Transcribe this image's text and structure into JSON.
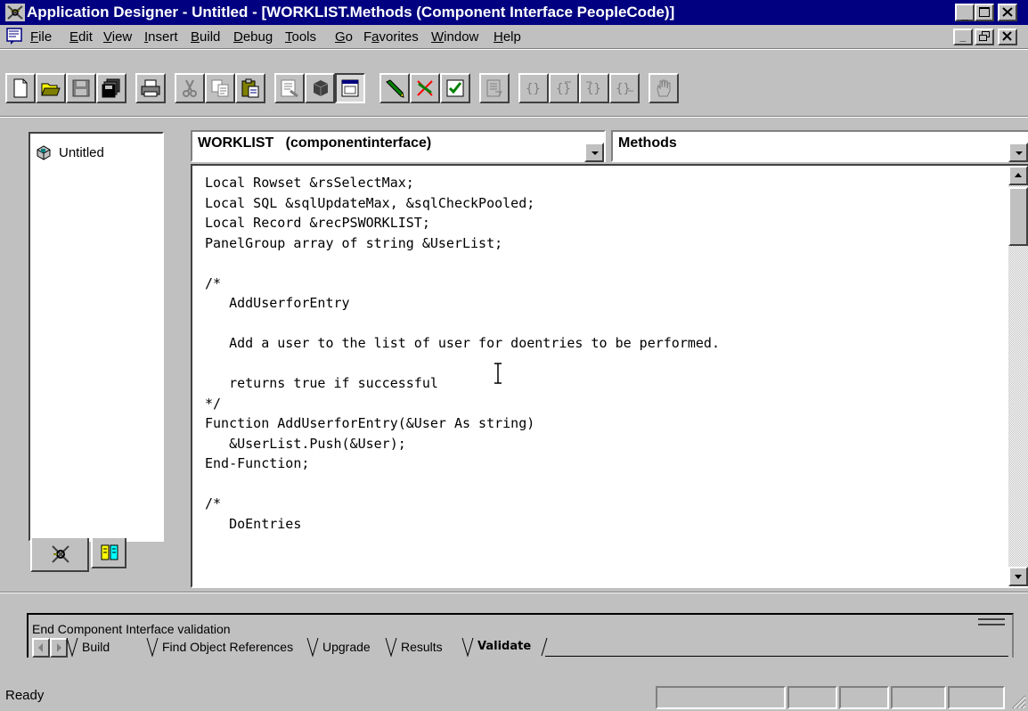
{
  "window": {
    "title": "Application Designer - Untitled - [WORKLIST.Methods (Component Interface PeopleCode)]"
  },
  "menu": {
    "items": [
      {
        "label": "File",
        "accel": "F"
      },
      {
        "label": "Edit",
        "accel": "E"
      },
      {
        "label": "View",
        "accel": "V"
      },
      {
        "label": "Insert",
        "accel": "I"
      },
      {
        "label": "Build",
        "accel": "B"
      },
      {
        "label": "Debug",
        "accel": "D"
      },
      {
        "label": "Tools",
        "accel": "T"
      },
      {
        "label": "Go",
        "accel": "G"
      },
      {
        "label": "Favorites",
        "accel": "a"
      },
      {
        "label": "Window",
        "accel": "W"
      },
      {
        "label": "Help",
        "accel": "H"
      }
    ]
  },
  "project": {
    "name": "Untitled"
  },
  "editor": {
    "object_combo": "WORKLIST   (componentinterface)",
    "event_combo": "Methods",
    "code_lines": [
      "Local Rowset &rsSelectMax;",
      "Local SQL &sqlUpdateMax, &sqlCheckPooled;",
      "Local Record &recPSWORKLIST;",
      "PanelGroup array of string &UserList;",
      "",
      "/*",
      "   AddUserforEntry",
      "",
      "   Add a user to the list of user for doentries to be performed.",
      "",
      "   returns true if successful",
      "*/",
      "Function AddUserforEntry(&User As string)",
      "   &UserList.Push(&User);",
      "End-Function;",
      "",
      "/*",
      "   DoEntries"
    ]
  },
  "output": {
    "message": "End Component Interface validation",
    "tabs": [
      "Build",
      "Find Object References",
      "Upgrade",
      "Results",
      "Validate"
    ],
    "active_tab": "Validate"
  },
  "status": {
    "text": "Ready"
  }
}
